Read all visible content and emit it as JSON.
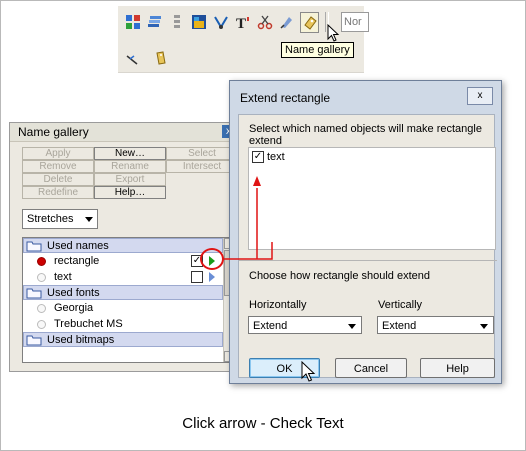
{
  "toolbar": {
    "tooltip": "Name gallery",
    "combo_text": "Nor",
    "icons": [
      "group-icon",
      "layers-icon",
      "align-icon",
      "fill-icon",
      "bevel-icon",
      "text-icon",
      "scissors-icon",
      "shadow-icon",
      "name-gallery-icon"
    ],
    "row2_icons": [
      "connector-icon",
      "tag-icon"
    ]
  },
  "gallery": {
    "title": "Name gallery",
    "close_label": "x",
    "buttons": [
      {
        "label": "Apply",
        "enabled": false
      },
      {
        "label": "New…",
        "enabled": true
      },
      {
        "label": "Select",
        "enabled": false
      },
      {
        "label": "Remove",
        "enabled": false
      },
      {
        "label": "Rename",
        "enabled": false
      },
      {
        "label": "Intersect",
        "enabled": false
      },
      {
        "label": "Delete",
        "enabled": false
      },
      {
        "label": "Export",
        "enabled": false
      },
      {
        "label": "Redefine",
        "enabled": false
      },
      {
        "label": "Help…",
        "enabled": true
      }
    ],
    "dropdown": "Stretches",
    "sections": {
      "used_names": "Used names",
      "used_fonts": "Used fonts",
      "used_bitmaps": "Used bitmaps"
    },
    "names": [
      {
        "label": "rectangle",
        "checked": true
      },
      {
        "label": "text",
        "checked": false
      }
    ],
    "fonts": [
      "Georgia",
      "Trebuchet MS"
    ]
  },
  "dialog": {
    "title": "Extend rectangle",
    "close_label": "x",
    "prompt1": "Select which named objects will make rectangle extend",
    "items": [
      {
        "label": "text",
        "checked": true
      }
    ],
    "prompt2": "Choose how rectangle should extend",
    "horizontal_label": "Horizontally",
    "horizontal_value": "Extend",
    "vertical_label": "Vertically",
    "vertical_value": "Extend",
    "ok": "OK",
    "cancel": "Cancel",
    "help": "Help"
  },
  "caption": "Click arrow - Check Text",
  "colors": {
    "accent_red": "#e01414",
    "play_green": "#1a9b1a",
    "section_blue": "#d3d9ef"
  }
}
